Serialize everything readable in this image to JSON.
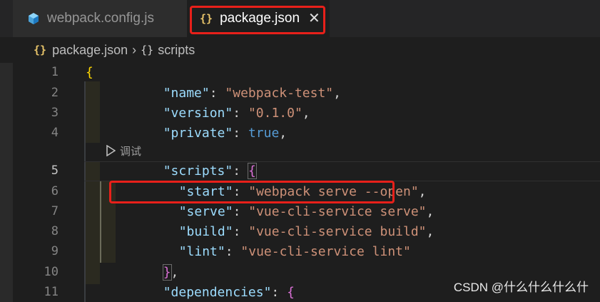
{
  "tabs": [
    {
      "label": "webpack.config.js",
      "icon": "webpack-cube-icon",
      "active": false
    },
    {
      "label": "package.json",
      "icon": "json-braces-icon",
      "active": true,
      "close": "✕"
    }
  ],
  "breadcrumb": {
    "file": "package.json",
    "separator": "›",
    "object_icon": "{}",
    "section": "scripts"
  },
  "editor": {
    "lines": [
      {
        "n": "1"
      },
      {
        "n": "2"
      },
      {
        "n": "3"
      },
      {
        "n": "4"
      },
      {
        "n": "5"
      },
      {
        "n": "6"
      },
      {
        "n": "7"
      },
      {
        "n": "8"
      },
      {
        "n": "9"
      },
      {
        "n": "10"
      },
      {
        "n": "11"
      }
    ],
    "codelens": "调试",
    "tokens": {
      "open_brace": "{",
      "name_key": "\"name\"",
      "name_val": "\"webpack-test\"",
      "version_key": "\"version\"",
      "version_val": "\"0.1.0\"",
      "private_key": "\"private\"",
      "private_val": "true",
      "scripts_key": "\"scripts\"",
      "start_key": "\"start\"",
      "start_val": "\"webpack serve --open\"",
      "serve_key": "\"serve\"",
      "serve_val": "\"vue-cli-service serve\"",
      "build_key": "\"build\"",
      "build_val": "\"vue-cli-service build\"",
      "lint_key": "\"lint\"",
      "lint_val": "\"vue-cli-service lint\"",
      "close_scripts": "}",
      "dependencies_key": "\"dependencies\""
    }
  },
  "watermark": "CSDN @什么什么什么什",
  "colors": {
    "annotation_box": "#e8201a",
    "string": "#ce9178",
    "key": "#9cdcfe",
    "keyword": "#569cd6"
  }
}
